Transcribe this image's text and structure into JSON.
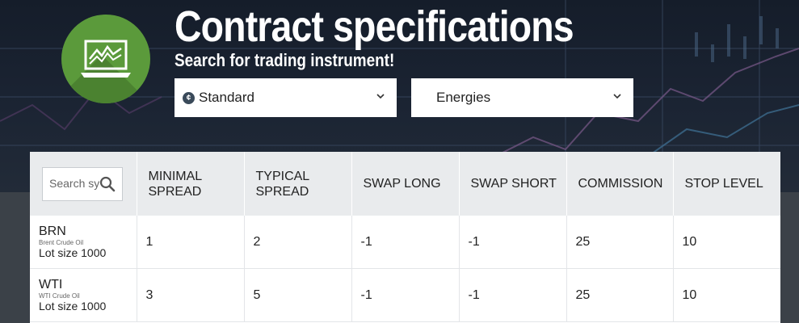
{
  "header": {
    "title": "Contract specifications",
    "subtitle": "Search for trading instrument!",
    "logo_icon": "laptop-chart-icon"
  },
  "filters": {
    "account_type": {
      "selected": "Standard",
      "icon": "currency-icon"
    },
    "category": {
      "selected": "Energies"
    }
  },
  "table": {
    "search_placeholder": "Search symbol",
    "columns": [
      "MINIMAL SPREAD",
      "TYPICAL SPREAD",
      "SWAP LONG",
      "SWAP SHORT",
      "COMMISSION",
      "STOP LEVEL"
    ],
    "rows": [
      {
        "symbol": "BRN",
        "name": "Brent Crude Oil",
        "lot": "Lot size 1000",
        "values": [
          "1",
          "2",
          "-1",
          "-1",
          "25",
          "10"
        ]
      },
      {
        "symbol": "WTI",
        "name": "WTI Crude Oil",
        "lot": "Lot size 1000",
        "values": [
          "3",
          "5",
          "-1",
          "-1",
          "25",
          "10"
        ]
      }
    ]
  },
  "colors": {
    "hero_bg": "#1b2433",
    "logo_green": "#5b9a3b",
    "header_row_bg": "#e9ebed",
    "page_bottom": "#3b4148"
  }
}
